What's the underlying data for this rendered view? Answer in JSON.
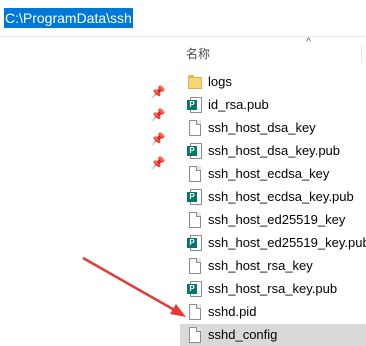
{
  "address": {
    "value": "C:\\ProgramData\\ssh"
  },
  "list_header": {
    "name_col": "名称"
  },
  "files": [
    {
      "name": "logs",
      "icon": "folder-icon"
    },
    {
      "name": "id_rsa.pub",
      "icon": "publisher-file-icon"
    },
    {
      "name": "ssh_host_dsa_key",
      "icon": "file-icon"
    },
    {
      "name": "ssh_host_dsa_key.pub",
      "icon": "publisher-file-icon"
    },
    {
      "name": "ssh_host_ecdsa_key",
      "icon": "file-icon"
    },
    {
      "name": "ssh_host_ecdsa_key.pub",
      "icon": "publisher-file-icon"
    },
    {
      "name": "ssh_host_ed25519_key",
      "icon": "file-icon"
    },
    {
      "name": "ssh_host_ed25519_key.pub",
      "icon": "publisher-file-icon"
    },
    {
      "name": "ssh_host_rsa_key",
      "icon": "file-icon"
    },
    {
      "name": "ssh_host_rsa_key.pub",
      "icon": "publisher-file-icon"
    },
    {
      "name": "sshd.pid",
      "icon": "file-icon"
    },
    {
      "name": "sshd_config",
      "icon": "file-icon",
      "selected": true
    }
  ],
  "colors": {
    "selection": "#0078d7",
    "arrow": "#e53935",
    "row_highlight": "#d9d9d9"
  }
}
